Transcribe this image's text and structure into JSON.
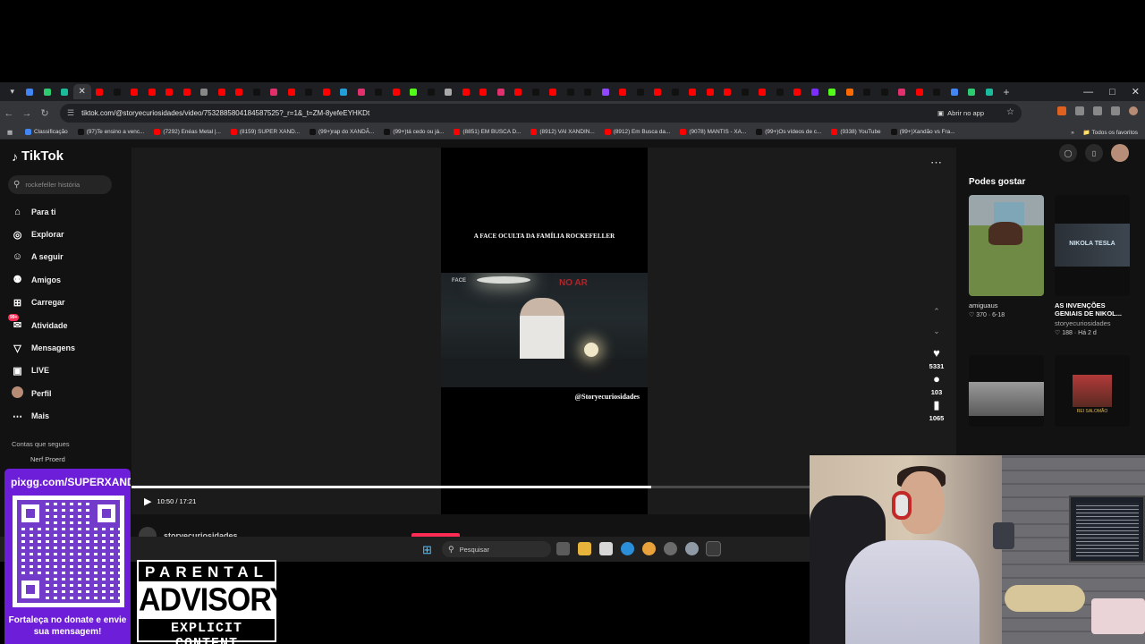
{
  "browser": {
    "tab_count": 56,
    "url": "tiktok.com/@storyecuriosidades/video/7532885804184587525?_r=1&_t=ZM-8yefeEYHKDt",
    "open_app": "Abrir no app",
    "bookmarks": [
      {
        "label": "Classificação",
        "color": "#4285f4"
      },
      {
        "label": "(97)Te ensino a venc...",
        "color": "#111111"
      },
      {
        "label": "(7292) Enéas Metal |...",
        "color": "#ff0000"
      },
      {
        "label": "(8159) SUPER XAND...",
        "color": "#ff0000"
      },
      {
        "label": "(99+)rap do XANDÃ...",
        "color": "#111111"
      },
      {
        "label": "(99+)tá cedo ou já...",
        "color": "#111111"
      },
      {
        "label": "(8851) EM BUSCA D...",
        "color": "#ff0000"
      },
      {
        "label": "(8912) VAI XANDIN...",
        "color": "#ff0000"
      },
      {
        "label": "(8912) Em Busca da...",
        "color": "#ff0000"
      },
      {
        "label": "(9078) MANTIS - XA...",
        "color": "#ff0000"
      },
      {
        "label": "(99+)Os vídeos de c...",
        "color": "#111111"
      },
      {
        "label": "(9338) YouTube",
        "color": "#ff0000"
      },
      {
        "label": "(99+)Xandão vs Fra...",
        "color": "#111111"
      }
    ],
    "all_bookmarks": "Todos os favoritos"
  },
  "tiktok": {
    "logo": "TikTok",
    "search_placeholder": "rockefeller história",
    "nav": [
      {
        "label": "Para ti",
        "icon": "home-icon"
      },
      {
        "label": "Explorar",
        "icon": "compass-icon"
      },
      {
        "label": "A seguir",
        "icon": "following-icon"
      },
      {
        "label": "Amigos",
        "icon": "friends-icon"
      },
      {
        "label": "Carregar",
        "icon": "upload-icon"
      },
      {
        "label": "Atividade",
        "icon": "activity-icon",
        "badge": "99+"
      },
      {
        "label": "Mensagens",
        "icon": "messages-icon"
      },
      {
        "label": "LIVE",
        "icon": "live-icon"
      },
      {
        "label": "Perfil",
        "icon": "profile-avatar"
      },
      {
        "label": "Mais",
        "icon": "more-icon"
      }
    ],
    "following_title": "Contas que segues",
    "following": [
      "Nerf Proerd"
    ],
    "video": {
      "title": "A FACE OCULTA DA FAMÍLIA ROCKEFELLER",
      "overlay_left": "FACE",
      "overlay_right": "NO AR",
      "handle": "@Storyecuriosidades",
      "time": "10:50 / 17:21",
      "progress": 0.63,
      "author": "storyecuriosidades"
    },
    "actions": {
      "likes": "5331",
      "comments": "103",
      "saves": "1065"
    },
    "suggestions_title": "Podes gostar",
    "suggestions": [
      {
        "title": "amiguaus",
        "likes": "370",
        "date": "6-18",
        "author": ""
      },
      {
        "title": "AS INVENÇÕES GENIAIS DE NIKOL...",
        "author": "storyecuriosidades",
        "likes": "188",
        "date": "Há 2 d",
        "thumb_text": "NIKOLA TESLA"
      },
      {
        "title": "",
        "author": "",
        "likes": "",
        "date": ""
      },
      {
        "title": "",
        "author": "",
        "likes": "",
        "date": "",
        "thumb_text": "REI SALOMÃO"
      }
    ]
  },
  "taskbar": {
    "search": "Pesquisar"
  },
  "overlay": {
    "qr_url": "pixgg.com/SUPERXAND...",
    "qr_message": "Fortaleça no donate e envie sua mensagem!",
    "advisory_top": "PARENTAL",
    "advisory_mid": "ADVISORY",
    "advisory_bottom": "EXPLICIT CONTENT"
  }
}
